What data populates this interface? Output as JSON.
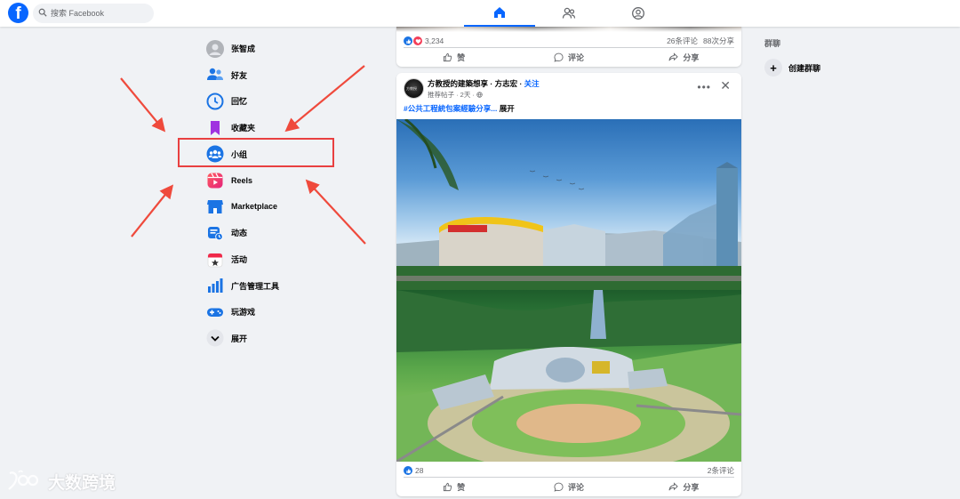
{
  "search": {
    "placeholder": "搜索 Facebook"
  },
  "nav": {
    "tabs": [
      "home-icon",
      "friends-icon",
      "profile-icon"
    ],
    "active": 0
  },
  "sidebar": {
    "items": [
      {
        "label": "张智成",
        "icon": "user-avatar-icon"
      },
      {
        "label": "好友",
        "icon": "friends-icon"
      },
      {
        "label": "回忆",
        "icon": "clock-icon"
      },
      {
        "label": "收藏夹",
        "icon": "bookmark-icon"
      },
      {
        "label": "小组",
        "icon": "groups-icon"
      },
      {
        "label": "Reels",
        "icon": "reels-icon"
      },
      {
        "label": "Marketplace",
        "icon": "store-icon"
      },
      {
        "label": "动态",
        "icon": "feed-icon"
      },
      {
        "label": "活动",
        "icon": "calendar-icon"
      },
      {
        "label": "广告管理工具",
        "icon": "ads-chart-icon"
      },
      {
        "label": "玩游戏",
        "icon": "gamepad-icon"
      },
      {
        "label": "展开",
        "icon": "chevron-down-icon"
      }
    ],
    "highlighted": "小组"
  },
  "posts": [
    {
      "reactions": "3,234",
      "comments": "26条评论",
      "shares": "88次分享",
      "actions": {
        "like": "赞",
        "comment": "评论",
        "share": "分享"
      }
    },
    {
      "author": "方教授的建築想享",
      "separator": " · ",
      "author_extra": "方志宏",
      "follow": "关注",
      "meta": "推荐帖子 · 2天 · ",
      "hashtag": "#公共工程統包案經驗分享...",
      "expand": "展开",
      "reactions": "28",
      "comments": "2条评论",
      "actions": {
        "like": "赞",
        "comment": "评论",
        "share": "分享"
      }
    }
  ],
  "right": {
    "title": "群聊",
    "create_label": "创建群聊"
  },
  "watermark": {
    "text": "大数跨境"
  },
  "colors": {
    "brand": "#0866ff",
    "highlight": "#e94040",
    "background": "#f0f2f5"
  }
}
